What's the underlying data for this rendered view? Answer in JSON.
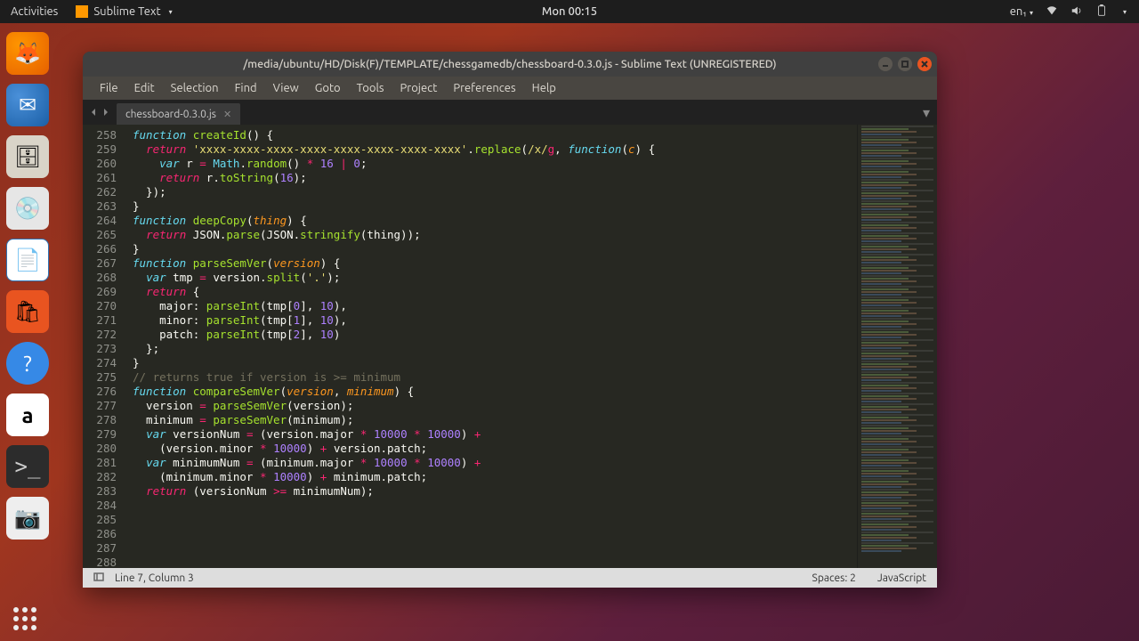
{
  "top_panel": {
    "activities": "Activities",
    "app_name": "Sublime Text",
    "clock": "Mon 00:15",
    "lang": "en₁"
  },
  "dock": {
    "icons": [
      "firefox",
      "thunderbird",
      "files",
      "disk",
      "writer",
      "software",
      "help",
      "amazon",
      "terminal",
      "camera"
    ]
  },
  "window": {
    "title": "/media/ubuntu/HD/Disk(F)/TEMPLATE/chessgamedb/chessboard-0.3.0.js - Sublime Text (UNREGISTERED)",
    "menus": [
      "File",
      "Edit",
      "Selection",
      "Find",
      "View",
      "Goto",
      "Tools",
      "Project",
      "Preferences",
      "Help"
    ],
    "tab": {
      "name": "chessboard-0.3.0.js"
    },
    "status": {
      "cursor": "Line 7, Column 3",
      "spaces": "Spaces: 2",
      "lang": "JavaScript"
    }
  },
  "code": {
    "first_line": 258,
    "lines": [
      [
        [
          "storage",
          "function"
        ],
        [
          "p",
          " "
        ],
        [
          "fn",
          "createId"
        ],
        [
          "p",
          "() {"
        ]
      ],
      [
        [
          "p",
          "  "
        ],
        [
          "kw",
          "return"
        ],
        [
          "p",
          " "
        ],
        [
          "str",
          "'xxxx-xxxx-xxxx-xxxx-xxxx-xxxx-xxxx-xxxx'"
        ],
        [
          "p",
          "."
        ],
        [
          "fn",
          "replace"
        ],
        [
          "p",
          "("
        ],
        [
          "str",
          "/x/"
        ],
        [
          "kw2",
          "g"
        ],
        [
          "p",
          ", "
        ],
        [
          "storage",
          "function"
        ],
        [
          "p",
          "("
        ],
        [
          "param",
          "c"
        ],
        [
          "p",
          ") {"
        ]
      ],
      [
        [
          "p",
          "    "
        ],
        [
          "storage",
          "var"
        ],
        [
          "p",
          " r "
        ],
        [
          "op",
          "="
        ],
        [
          "p",
          " "
        ],
        [
          "builtin",
          "Math"
        ],
        [
          "p",
          "."
        ],
        [
          "fn",
          "random"
        ],
        [
          "p",
          "() "
        ],
        [
          "op",
          "*"
        ],
        [
          "p",
          " "
        ],
        [
          "num",
          "16"
        ],
        [
          "p",
          " "
        ],
        [
          "op",
          "|"
        ],
        [
          "p",
          " "
        ],
        [
          "num",
          "0"
        ],
        [
          "p",
          ";"
        ]
      ],
      [
        [
          "p",
          "    "
        ],
        [
          "kw",
          "return"
        ],
        [
          "p",
          " r."
        ],
        [
          "fn",
          "toString"
        ],
        [
          "p",
          "("
        ],
        [
          "num",
          "16"
        ],
        [
          "p",
          ");"
        ]
      ],
      [
        [
          "p",
          "  });"
        ]
      ],
      [
        [
          "p",
          "}"
        ]
      ],
      [
        [
          "p",
          ""
        ]
      ],
      [
        [
          "storage",
          "function"
        ],
        [
          "p",
          " "
        ],
        [
          "fn",
          "deepCopy"
        ],
        [
          "p",
          "("
        ],
        [
          "param",
          "thing"
        ],
        [
          "p",
          ") {"
        ]
      ],
      [
        [
          "p",
          "  "
        ],
        [
          "kw",
          "return"
        ],
        [
          "p",
          " JSON."
        ],
        [
          "fn",
          "parse"
        ],
        [
          "p",
          "(JSON."
        ],
        [
          "fn",
          "stringify"
        ],
        [
          "p",
          "(thing));"
        ]
      ],
      [
        [
          "p",
          "}"
        ]
      ],
      [
        [
          "p",
          ""
        ]
      ],
      [
        [
          "storage",
          "function"
        ],
        [
          "p",
          " "
        ],
        [
          "fn",
          "parseSemVer"
        ],
        [
          "p",
          "("
        ],
        [
          "param",
          "version"
        ],
        [
          "p",
          ") {"
        ]
      ],
      [
        [
          "p",
          "  "
        ],
        [
          "storage",
          "var"
        ],
        [
          "p",
          " tmp "
        ],
        [
          "op",
          "="
        ],
        [
          "p",
          " version."
        ],
        [
          "fn",
          "split"
        ],
        [
          "p",
          "("
        ],
        [
          "str",
          "'.'"
        ],
        [
          "p",
          ");"
        ]
      ],
      [
        [
          "p",
          "  "
        ],
        [
          "kw",
          "return"
        ],
        [
          "p",
          " {"
        ]
      ],
      [
        [
          "p",
          "    major: "
        ],
        [
          "fn",
          "parseInt"
        ],
        [
          "p",
          "(tmp["
        ],
        [
          "num",
          "0"
        ],
        [
          "p",
          "], "
        ],
        [
          "num",
          "10"
        ],
        [
          "p",
          "),"
        ]
      ],
      [
        [
          "p",
          "    minor: "
        ],
        [
          "fn",
          "parseInt"
        ],
        [
          "p",
          "(tmp["
        ],
        [
          "num",
          "1"
        ],
        [
          "p",
          "], "
        ],
        [
          "num",
          "10"
        ],
        [
          "p",
          "),"
        ]
      ],
      [
        [
          "p",
          "    patch: "
        ],
        [
          "fn",
          "parseInt"
        ],
        [
          "p",
          "(tmp["
        ],
        [
          "num",
          "2"
        ],
        [
          "p",
          "], "
        ],
        [
          "num",
          "10"
        ],
        [
          "p",
          ")"
        ]
      ],
      [
        [
          "p",
          "  };"
        ]
      ],
      [
        [
          "p",
          "}"
        ]
      ],
      [
        [
          "p",
          ""
        ]
      ],
      [
        [
          "cm",
          "// returns true if version is >= minimum"
        ]
      ],
      [
        [
          "storage",
          "function"
        ],
        [
          "p",
          " "
        ],
        [
          "fn",
          "compareSemVer"
        ],
        [
          "p",
          "("
        ],
        [
          "param",
          "version"
        ],
        [
          "p",
          ", "
        ],
        [
          "param",
          "minimum"
        ],
        [
          "p",
          ") {"
        ]
      ],
      [
        [
          "p",
          "  version "
        ],
        [
          "op",
          "="
        ],
        [
          "p",
          " "
        ],
        [
          "fn",
          "parseSemVer"
        ],
        [
          "p",
          "(version);"
        ]
      ],
      [
        [
          "p",
          "  minimum "
        ],
        [
          "op",
          "="
        ],
        [
          "p",
          " "
        ],
        [
          "fn",
          "parseSemVer"
        ],
        [
          "p",
          "(minimum);"
        ]
      ],
      [
        [
          "p",
          ""
        ]
      ],
      [
        [
          "p",
          "  "
        ],
        [
          "storage",
          "var"
        ],
        [
          "p",
          " versionNum "
        ],
        [
          "op",
          "="
        ],
        [
          "p",
          " (version.major "
        ],
        [
          "op",
          "*"
        ],
        [
          "p",
          " "
        ],
        [
          "num",
          "10000"
        ],
        [
          "p",
          " "
        ],
        [
          "op",
          "*"
        ],
        [
          "p",
          " "
        ],
        [
          "num",
          "10000"
        ],
        [
          "p",
          ") "
        ],
        [
          "op",
          "+"
        ]
      ],
      [
        [
          "p",
          "    (version.minor "
        ],
        [
          "op",
          "*"
        ],
        [
          "p",
          " "
        ],
        [
          "num",
          "10000"
        ],
        [
          "p",
          ") "
        ],
        [
          "op",
          "+"
        ],
        [
          "p",
          " version.patch;"
        ]
      ],
      [
        [
          "p",
          "  "
        ],
        [
          "storage",
          "var"
        ],
        [
          "p",
          " minimumNum "
        ],
        [
          "op",
          "="
        ],
        [
          "p",
          " (minimum.major "
        ],
        [
          "op",
          "*"
        ],
        [
          "p",
          " "
        ],
        [
          "num",
          "10000"
        ],
        [
          "p",
          " "
        ],
        [
          "op",
          "*"
        ],
        [
          "p",
          " "
        ],
        [
          "num",
          "10000"
        ],
        [
          "p",
          ") "
        ],
        [
          "op",
          "+"
        ]
      ],
      [
        [
          "p",
          "    (minimum.minor "
        ],
        [
          "op",
          "*"
        ],
        [
          "p",
          " "
        ],
        [
          "num",
          "10000"
        ],
        [
          "p",
          ") "
        ],
        [
          "op",
          "+"
        ],
        [
          "p",
          " minimum.patch;"
        ]
      ],
      [
        [
          "p",
          ""
        ]
      ],
      [
        [
          "p",
          "  "
        ],
        [
          "kw",
          "return"
        ],
        [
          "p",
          " (versionNum "
        ],
        [
          "op",
          ">="
        ],
        [
          "p",
          " minimumNum);"
        ]
      ]
    ]
  }
}
